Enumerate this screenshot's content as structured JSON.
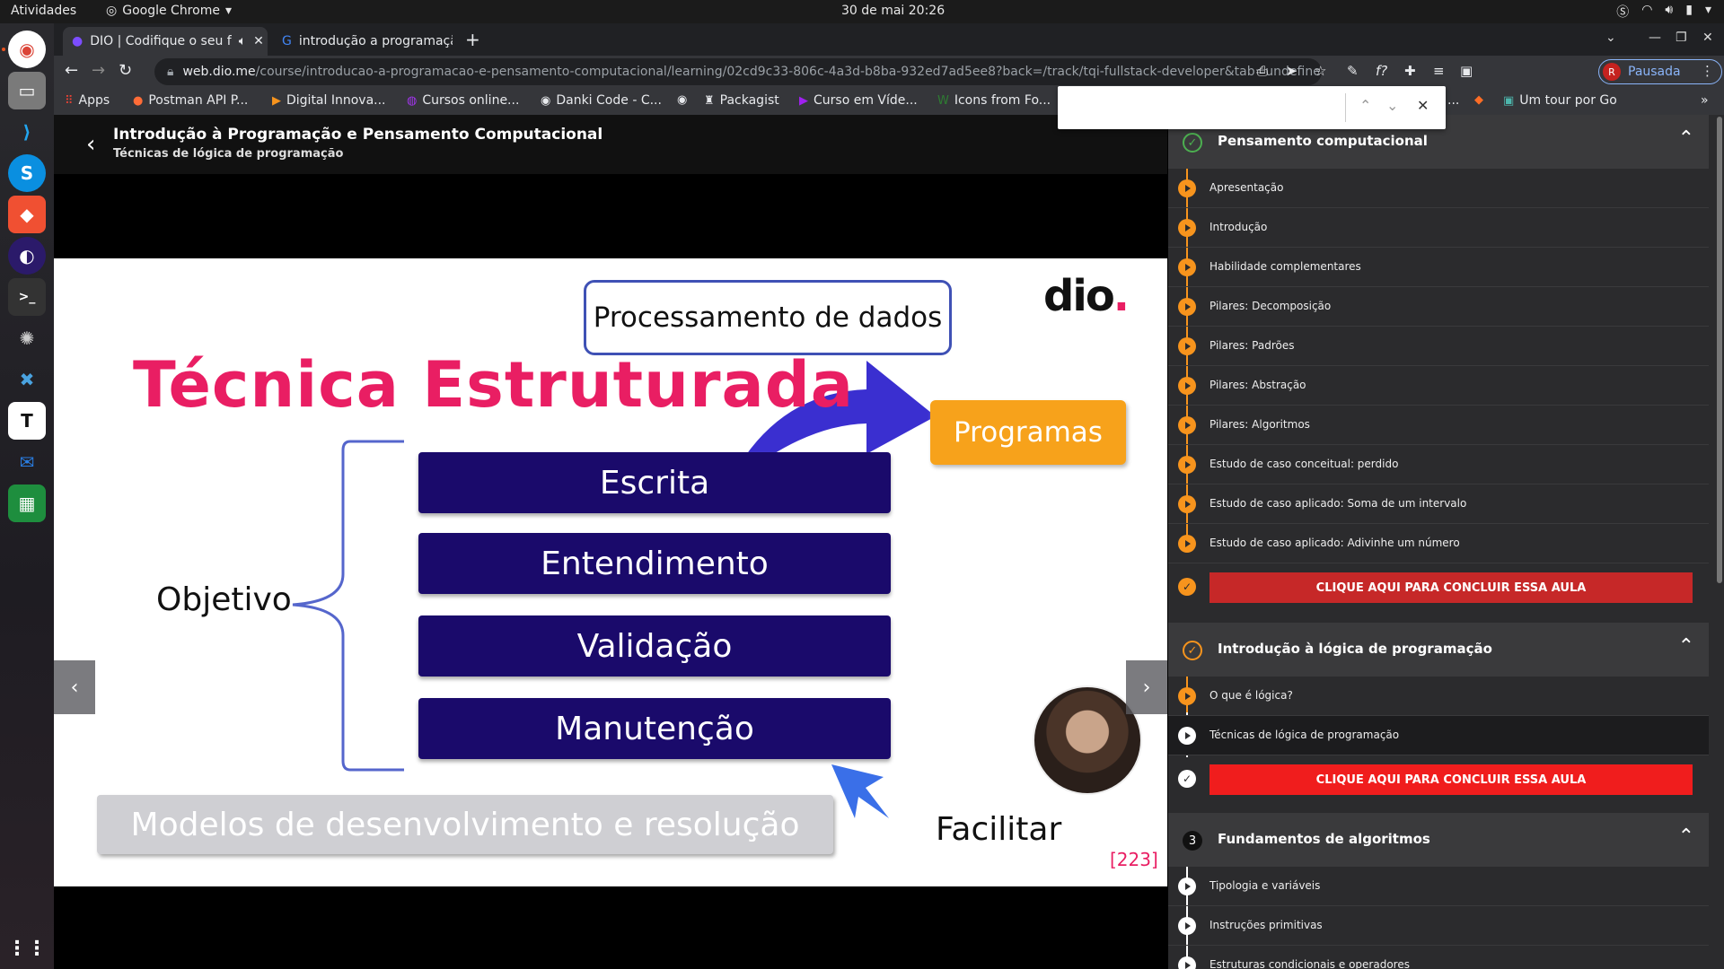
{
  "topbar": {
    "activities": "Atividades",
    "app_name": "Google Chrome",
    "clock": "30 de mai  20:26"
  },
  "tabs": [
    {
      "title": "DIO | Codifique o seu f"
    },
    {
      "title": "introdução a programaçã"
    }
  ],
  "toolbar": {
    "url_host": "web.dio.me",
    "url_path": "/course/introducao-a-programacao-e-pensamento-computacional/learning/02cd9c33-806c-4a3d-b8ba-932ed7ad5ee8?back=/track/tqi-fullstack-developer&tab=undefined&moduleId=undefined",
    "profile_initial": "R",
    "profile_label": "Pausada"
  },
  "bookmarks": [
    {
      "label": "Apps",
      "icon": "apps-grid-icon"
    },
    {
      "label": "Postman API P...",
      "icon": "postman-icon"
    },
    {
      "label": "Digital Innova...",
      "icon": "dio-icon"
    },
    {
      "label": "Cursos online...",
      "icon": "udemy-icon"
    },
    {
      "label": "Danki Code - C...",
      "icon": "github-icon"
    },
    {
      "label": "",
      "icon": "github-icon"
    },
    {
      "label": "Packagist",
      "icon": "packagist-icon"
    },
    {
      "label": "Curso em Víde...",
      "icon": "play-icon"
    },
    {
      "label": "Icons from Fo...",
      "icon": "web-icon"
    },
    {
      "label": "...",
      "icon": ""
    },
    {
      "label": "",
      "icon": "gitlab-icon"
    },
    {
      "label": "Um tour por Go",
      "icon": "bookmark-icon"
    }
  ],
  "course": {
    "title": "Introdução à Programação e Pensamento Computacional",
    "lesson": "Técnicas de lógica de programação"
  },
  "slide": {
    "title": "Técnica Estruturada",
    "processamento": "Processamento de dados",
    "programas": "Programas",
    "stack": [
      "Escrita",
      "Entendimento",
      "Validação",
      "Manutenção"
    ],
    "objetivo": "Objetivo",
    "modelos": "Modelos de desenvolvimento e resolução",
    "facilitar": "Facilitar",
    "logo": "dio",
    "page_number": "[223]",
    "colors": {
      "title": "#e91e63",
      "stack": "#1a0a6b",
      "programas": "#f7a21b"
    }
  },
  "sidebar": {
    "sections": [
      {
        "number": "✓",
        "title": "Pensamento computacional",
        "items": [
          "Apresentação",
          "Introdução",
          "Habilidade complementares",
          "Pilares: Decomposição",
          "Pilares: Padrões",
          "Pilares: Abstração",
          "Pilares: Algoritmos",
          "Estudo de caso conceitual: perdido",
          "Estudo de caso aplicado: Soma de um intervalo",
          "Estudo de caso aplicado: Adivinhe um número"
        ],
        "conclude": "CLIQUE AQUI PARA CONCLUIR ESSA AULA"
      },
      {
        "number": "✓",
        "title": "Introdução à lógica de programação",
        "items": [
          "O que é lógica?",
          "Técnicas de lógica de programação"
        ],
        "conclude": "CLIQUE AQUI PARA CONCLUIR ESSA AULA"
      },
      {
        "number": "3",
        "title": "Fundamentos de algoritmos",
        "items": [
          "Tipologia e variáveis",
          "Instruções primitivas",
          "Estruturas condicionais e operadores"
        ]
      }
    ]
  }
}
